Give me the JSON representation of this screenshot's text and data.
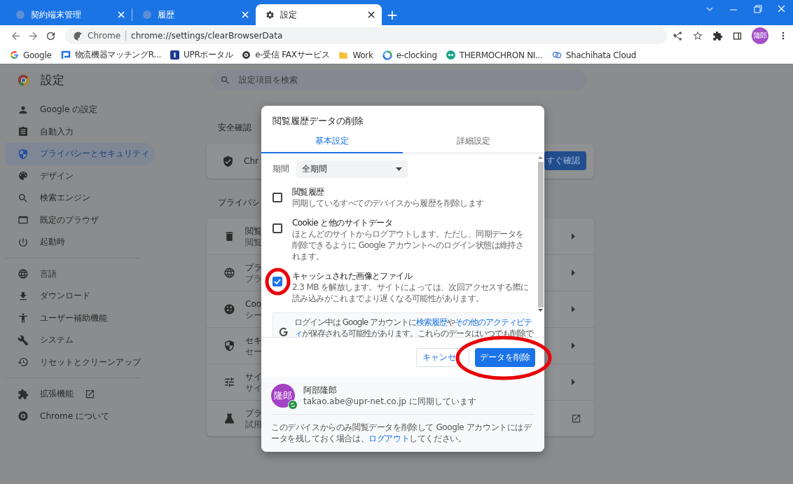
{
  "tabs": [
    {
      "title": "契約端末管理",
      "selected": false
    },
    {
      "title": "履歴",
      "selected": false
    },
    {
      "title": "設定",
      "selected": true
    }
  ],
  "new_tab": "+",
  "address_bar": {
    "site_label": "Chrome",
    "url": "chrome://settings/clearBrowserData"
  },
  "profile_avatar": "隆郎",
  "bookmarks": [
    "Google",
    "物流機器マッチングR...",
    "UPRポータル",
    "e-受信 FAXサービス",
    "Work",
    "e-clocking",
    "THERMOCHRON NI...",
    "Shachihata Cloud"
  ],
  "settings": {
    "title": "設定",
    "search_placeholder": "設定項目を検索",
    "nav_sections": [
      [
        {
          "label": "Google の設定",
          "selected": false,
          "external": false
        },
        {
          "label": "自動入力",
          "selected": false,
          "external": false
        },
        {
          "label": "プライバシーとセキュリティ",
          "selected": true,
          "external": false
        },
        {
          "label": "デザイン",
          "selected": false,
          "external": false
        },
        {
          "label": "検索エンジン",
          "selected": false,
          "external": false
        },
        {
          "label": "既定のブラウザ",
          "selected": false,
          "external": false
        },
        {
          "label": "起動時",
          "selected": false,
          "external": false
        }
      ],
      [
        {
          "label": "言語",
          "selected": false,
          "external": false
        },
        {
          "label": "ダウンロード",
          "selected": false,
          "external": false
        },
        {
          "label": "ユーザー補助機能",
          "selected": false,
          "external": false
        },
        {
          "label": "システム",
          "selected": false,
          "external": false
        },
        {
          "label": "リセットとクリーンアップ",
          "selected": false,
          "external": false
        }
      ],
      [
        {
          "label": "拡張機能",
          "selected": false,
          "external": true
        },
        {
          "label": "Chrome について",
          "selected": false,
          "external": false
        }
      ]
    ],
    "safety_check": {
      "heading": "安全確認",
      "text": "Chr",
      "button": "すぐ確認"
    },
    "privacy": {
      "heading": "プライバシ",
      "rows": [
        {
          "title": "閲覧",
          "subtitle": "閲覧",
          "external": false
        },
        {
          "title": "プラ",
          "subtitle": "プラ",
          "external": false
        },
        {
          "title": "Coo",
          "subtitle": "シー",
          "external": false
        },
        {
          "title": "セキ",
          "subtitle": "セー",
          "external": false
        },
        {
          "title": "サイ",
          "subtitle": "サイ",
          "external": false
        },
        {
          "title": "プラ",
          "subtitle": "試用",
          "external": true
        }
      ]
    }
  },
  "dialog": {
    "title": "閲覧履歴データの削除",
    "tabs": [
      {
        "label": "基本設定",
        "selected": true
      },
      {
        "label": "詳細設定",
        "selected": false
      }
    ],
    "time_range": {
      "label": "期間",
      "value": "全期間"
    },
    "items": [
      {
        "title": "閲覧履歴",
        "description": "同期しているすべてのデバイスから履歴を削除します",
        "checked": false,
        "circled": false
      },
      {
        "title": "Cookie と他のサイトデータ",
        "description": "ほとんどのサイトからログアウトします。ただし、同期データを削除できるように Google アカウントへのログイン状態は維持されます。",
        "checked": false,
        "circled": false
      },
      {
        "title": "キャッシュされた画像とファイル",
        "description": "2.3 MB を解放します。サイトによっては、次回アクセスする際に読み込みがこれまでより遅くなる可能性があります。",
        "checked": true,
        "circled": true
      }
    ],
    "info_lines": [
      [
        {
          "text": "ログイン中は Google アカウントに",
          "link": false
        },
        {
          "text": "検索履歴",
          "link": true
        },
        {
          "text": "や",
          "link": false
        },
        {
          "text": "その他のアクティビテ",
          "link": true
        }
      ],
      [
        {
          "text": "ィ",
          "link": true
        },
        {
          "text": "が保存される可能性があります。これらのデータはいつでも削除で",
          "link": false
        }
      ]
    ],
    "buttons": [
      {
        "label": "キャンセ",
        "kind": "secondary",
        "circled": false
      },
      {
        "label": "データを削除",
        "kind": "primary",
        "circled": true
      }
    ],
    "account": {
      "avatar": "隆郎",
      "name": "阿部隆郎",
      "sync": "takao.abe@upr-net.co.jp に同期しています"
    },
    "footer": [
      {
        "text": "このデバイスからのみ閲覧データを削除して Google アカウントにはデータを残しておく場合は、",
        "link": false
      },
      {
        "text": "ログアウト",
        "link": true
      },
      {
        "text": "してください。",
        "link": false
      }
    ]
  }
}
